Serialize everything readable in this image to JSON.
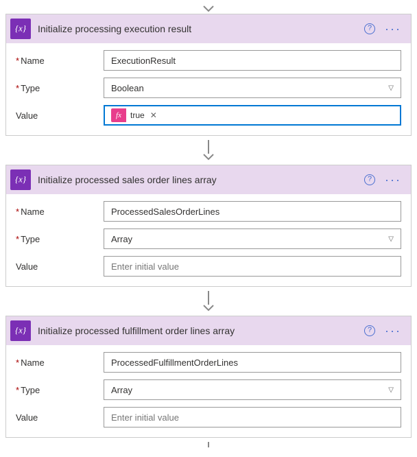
{
  "cards": [
    {
      "title": "Initialize processing execution result",
      "name_label": "Name",
      "name_value": "ExecutionResult",
      "type_label": "Type",
      "type_value": "Boolean",
      "value_label": "Value",
      "value_token": "true",
      "value_active": true
    },
    {
      "title": "Initialize processed sales order lines array",
      "name_label": "Name",
      "name_value": "ProcessedSalesOrderLines",
      "type_label": "Type",
      "type_value": "Array",
      "value_label": "Value",
      "value_placeholder": "Enter initial value"
    },
    {
      "title": "Initialize processed fulfillment order lines array",
      "name_label": "Name",
      "name_value": "ProcessedFulfillmentOrderLines",
      "type_label": "Type",
      "type_value": "Array",
      "value_label": "Value",
      "value_placeholder": "Enter initial value"
    }
  ]
}
